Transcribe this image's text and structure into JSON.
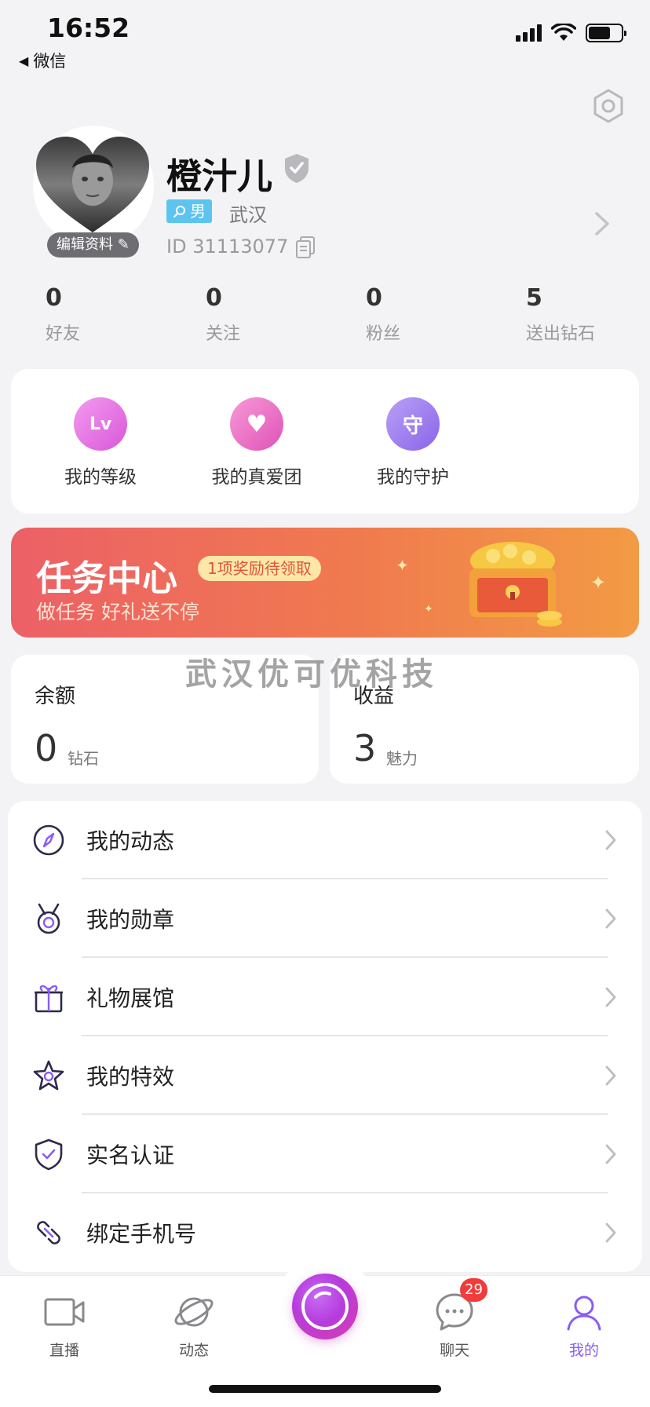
{
  "status_bar": {
    "time": "16:52",
    "back_app": "微信"
  },
  "profile": {
    "nickname": "橙汁儿",
    "edit_label": "编辑资料",
    "gender": "男",
    "city": "武汉",
    "id_text": "ID 31113077"
  },
  "stats": [
    {
      "value": "0",
      "label": "好友"
    },
    {
      "value": "0",
      "label": "关注"
    },
    {
      "value": "0",
      "label": "粉丝"
    },
    {
      "value": "5",
      "label": "送出钻石"
    }
  ],
  "features": [
    {
      "label": "我的等级",
      "icon": "level-icon",
      "glyph": "Lv"
    },
    {
      "label": "我的真爱团",
      "icon": "heart-crown-icon",
      "glyph": "♥"
    },
    {
      "label": "我的守护",
      "icon": "guard-icon",
      "glyph": "守"
    }
  ],
  "task": {
    "title": "任务中心",
    "badge": "1项奖励待领取",
    "subtitle": "做任务 好礼送不停"
  },
  "watermark": "武汉优可优科技",
  "balance": {
    "title": "余额",
    "value": "0",
    "unit": "钻石"
  },
  "income": {
    "title": "收益",
    "value": "3",
    "unit": "魅力"
  },
  "menu": [
    {
      "label": "我的动态",
      "icon": "compass-icon"
    },
    {
      "label": "我的勋章",
      "icon": "medal-icon"
    },
    {
      "label": "礼物展馆",
      "icon": "gift-icon"
    },
    {
      "label": "我的特效",
      "icon": "star-icon"
    },
    {
      "label": "实名认证",
      "icon": "shield-check-icon"
    },
    {
      "label": "绑定手机号",
      "icon": "link-icon"
    }
  ],
  "tabs": [
    {
      "label": "直播",
      "icon": "camera-icon"
    },
    {
      "label": "动态",
      "icon": "planet-icon"
    },
    {
      "label": "聊天",
      "icon": "chat-icon"
    },
    {
      "label": "我的",
      "icon": "user-icon"
    }
  ],
  "chat_badge": "29",
  "colors": {
    "accent": "#8b5cf6",
    "banner_start": "#ec6067",
    "banner_end": "#f29b44",
    "badge_red": "#f23b3b",
    "gender_blue": "#5cc4ef"
  }
}
